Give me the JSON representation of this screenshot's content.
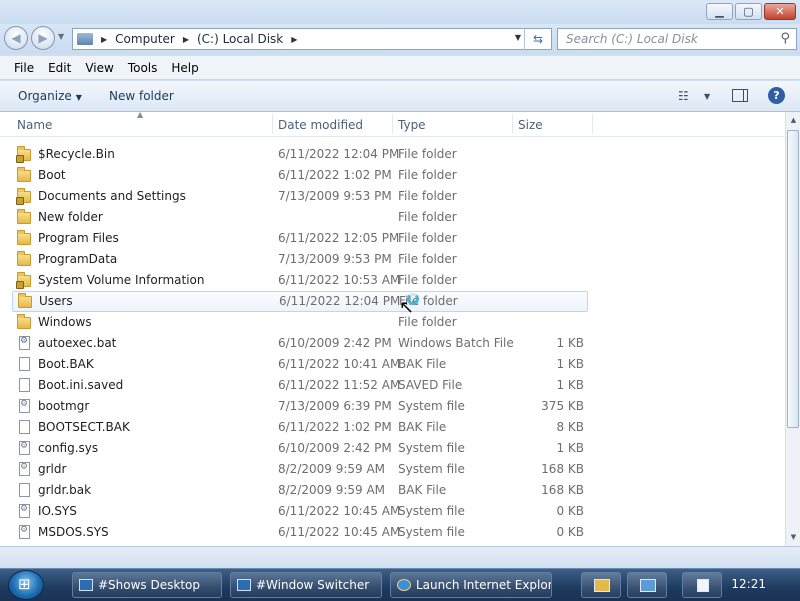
{
  "window": {
    "buttons": [
      "minimize",
      "maximize",
      "close"
    ]
  },
  "nav": {
    "breadcrumb": [
      "Computer",
      "(C:) Local Disk"
    ],
    "search_placeholder": "Search (C:) Local Disk"
  },
  "menu": [
    "File",
    "Edit",
    "View",
    "Tools",
    "Help"
  ],
  "toolbar": {
    "organize": "Organize",
    "new_folder": "New folder"
  },
  "columns": {
    "name": "Name",
    "date": "Date modified",
    "type": "Type",
    "size": "Size"
  },
  "files": [
    {
      "name": "$Recycle.Bin",
      "date": "6/11/2022 12:04 PM",
      "type": "File folder",
      "size": "",
      "icon": "locked-folder-icon"
    },
    {
      "name": "Boot",
      "date": "6/11/2022 1:02 PM",
      "type": "File folder",
      "size": "",
      "icon": "folder-icon"
    },
    {
      "name": "Documents and Settings",
      "date": "7/13/2009 9:53 PM",
      "type": "File folder",
      "size": "",
      "icon": "locked-folder-icon"
    },
    {
      "name": "New folder",
      "date": "",
      "type": "File folder",
      "size": "",
      "icon": "folder-icon"
    },
    {
      "name": "Program Files",
      "date": "6/11/2022 12:05 PM",
      "type": "File folder",
      "size": "",
      "icon": "folder-icon"
    },
    {
      "name": "ProgramData",
      "date": "7/13/2009 9:53 PM",
      "type": "File folder",
      "size": "",
      "icon": "folder-icon"
    },
    {
      "name": "System Volume Information",
      "date": "6/11/2022 10:53 AM",
      "type": "File folder",
      "size": "",
      "icon": "locked-folder-icon"
    },
    {
      "name": "Users",
      "date": "6/11/2022 12:04 PM",
      "type": "File folder",
      "size": "",
      "icon": "folder-icon",
      "hover": true
    },
    {
      "name": "Windows",
      "date": "",
      "type": "File folder",
      "size": "",
      "icon": "folder-icon"
    },
    {
      "name": "autoexec.bat",
      "date": "6/10/2009 2:42 PM",
      "type": "Windows Batch File",
      "size": "1 KB",
      "icon": "batch-file-icon"
    },
    {
      "name": "Boot.BAK",
      "date": "6/11/2022 10:41 AM",
      "type": "BAK File",
      "size": "1 KB",
      "icon": "file-icon"
    },
    {
      "name": "Boot.ini.saved",
      "date": "6/11/2022 11:52 AM",
      "type": "SAVED File",
      "size": "1 KB",
      "icon": "file-icon"
    },
    {
      "name": "bootmgr",
      "date": "7/13/2009 6:39 PM",
      "type": "System file",
      "size": "375 KB",
      "icon": "system-file-icon"
    },
    {
      "name": "BOOTSECT.BAK",
      "date": "6/11/2022 1:02 PM",
      "type": "BAK File",
      "size": "8 KB",
      "icon": "file-icon"
    },
    {
      "name": "config.sys",
      "date": "6/10/2009 2:42 PM",
      "type": "System file",
      "size": "1 KB",
      "icon": "system-file-icon"
    },
    {
      "name": "grldr",
      "date": "8/2/2009 9:59 AM",
      "type": "System file",
      "size": "168 KB",
      "icon": "system-file-icon"
    },
    {
      "name": "grldr.bak",
      "date": "8/2/2009 9:59 AM",
      "type": "BAK File",
      "size": "168 KB",
      "icon": "file-icon"
    },
    {
      "name": "IO.SYS",
      "date": "6/11/2022 10:45 AM",
      "type": "System file",
      "size": "0 KB",
      "icon": "system-file-icon"
    },
    {
      "name": "MSDOS.SYS",
      "date": "6/11/2022 10:45 AM",
      "type": "System file",
      "size": "0 KB",
      "icon": "system-file-icon"
    }
  ],
  "taskbar": {
    "items": [
      "#Shows Desktop",
      "#Window Switcher",
      "Launch Internet Explore..."
    ],
    "clock": "12:21"
  }
}
